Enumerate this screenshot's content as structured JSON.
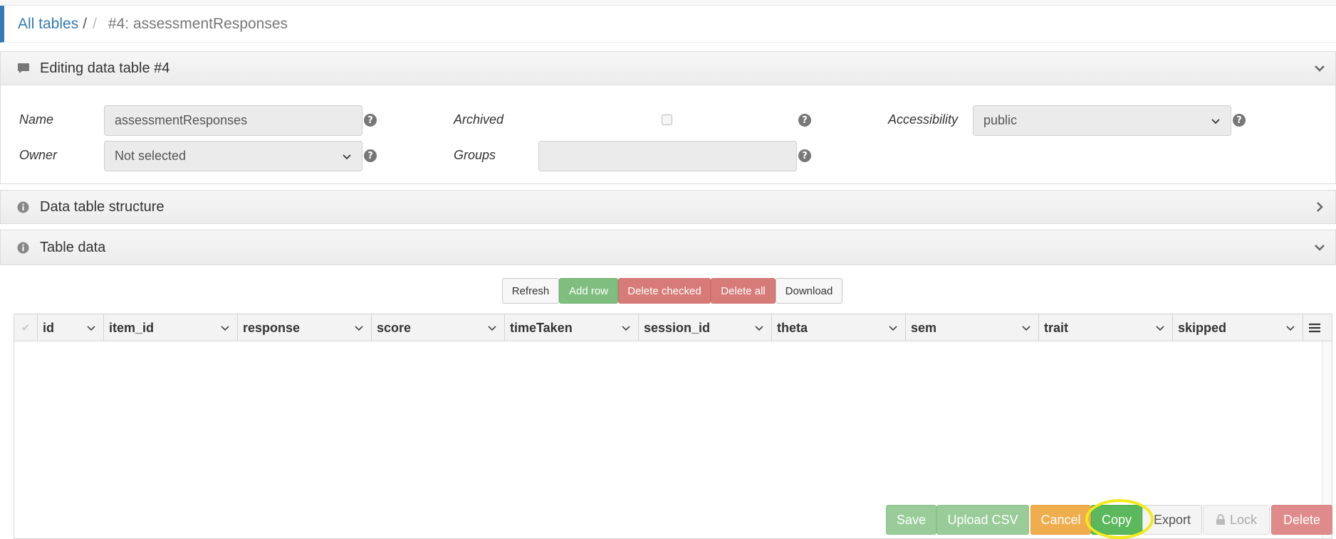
{
  "breadcrumb": {
    "root_label": "All tables",
    "separator": "/",
    "separator2": "/",
    "current": "#4: assessmentResponses"
  },
  "editing_panel": {
    "title": "Editing data table #4",
    "icon": "comment-icon",
    "state": "expanded"
  },
  "form": {
    "name_label": "Name",
    "name_value": "assessmentResponses",
    "owner_label": "Owner",
    "owner_value": "Not selected",
    "archived_label": "Archived",
    "archived_checked": false,
    "groups_label": "Groups",
    "groups_value": "",
    "accessibility_label": "Accessibility",
    "accessibility_value": "public",
    "help_icon_text": "?"
  },
  "structure_panel": {
    "title": "Data table structure",
    "icon": "info-icon",
    "state": "collapsed"
  },
  "table_data_panel": {
    "title": "Table data",
    "icon": "info-icon",
    "state": "expanded"
  },
  "toolbar": {
    "refresh": "Refresh",
    "add_row": "Add row",
    "delete_checked": "Delete checked",
    "delete_all": "Delete all",
    "download": "Download"
  },
  "grid": {
    "check_glyph": "✔",
    "columns": [
      "id",
      "item_id",
      "response",
      "score",
      "timeTaken",
      "session_id",
      "theta",
      "sem",
      "trait",
      "skipped"
    ],
    "rows": []
  },
  "actions": {
    "save": "Save",
    "upload_csv": "Upload CSV",
    "cancel": "Cancel",
    "copy": "Copy",
    "export": "Export",
    "lock": "Lock",
    "delete": "Delete"
  },
  "colors": {
    "link": "#337ab7",
    "success": "#5cb85c",
    "success_light": "#7fbe7f",
    "danger_light": "#d77b78",
    "warning": "#f0ad4e",
    "highlight": "#f2ea1a"
  }
}
